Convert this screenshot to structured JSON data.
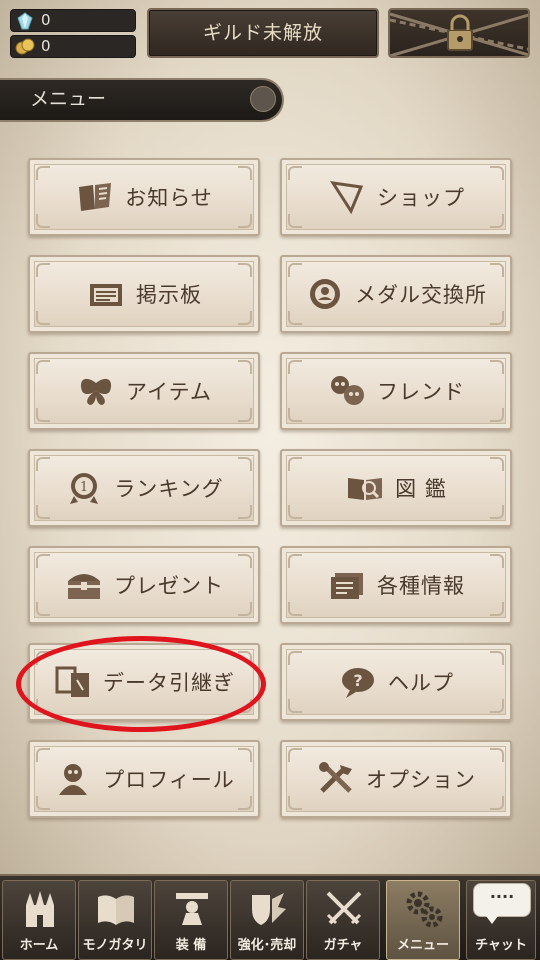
{
  "resources": {
    "gems": "0",
    "coins": "0",
    "gem_icon": "crystal-icon",
    "coin_icon": "coins-icon"
  },
  "guild_button_label": "ギルド未解放",
  "locked_icon": "padlock-chains-icon",
  "menu_header_label": "メニュー",
  "menu_buttons": [
    {
      "label": "お知らせ",
      "icon": "news-icon"
    },
    {
      "label": "ショップ",
      "icon": "shop-icon"
    },
    {
      "label": "掲示板",
      "icon": "board-icon"
    },
    {
      "label": "メダル交換所",
      "icon": "medal-exchange-icon"
    },
    {
      "label": "アイテム",
      "icon": "butterfly-icon"
    },
    {
      "label": "フレンド",
      "icon": "friends-icon"
    },
    {
      "label": "ランキング",
      "icon": "ranking-icon"
    },
    {
      "label": "図 鑑",
      "icon": "encyclopedia-icon"
    },
    {
      "label": "プレゼント",
      "icon": "present-chest-icon"
    },
    {
      "label": "各種情報",
      "icon": "info-icon"
    },
    {
      "label": "データ引継ぎ",
      "icon": "data-transfer-icon"
    },
    {
      "label": "ヘルプ",
      "icon": "help-icon"
    },
    {
      "label": "プロフィール",
      "icon": "profile-icon"
    },
    {
      "label": "オプション",
      "icon": "options-tools-icon"
    }
  ],
  "highlighted_button": "データ引継ぎ",
  "highlight_color": "#e0141c",
  "bottom_nav": [
    {
      "label": "ホーム",
      "icon": "castle-icon",
      "active": false
    },
    {
      "label": "モノガタリ",
      "icon": "book-icon",
      "active": false
    },
    {
      "label": "装 備",
      "icon": "equipment-icon",
      "active": false
    },
    {
      "label": "強化･売却",
      "icon": "enhance-sell-icon",
      "active": false
    },
    {
      "label": "ガチャ",
      "icon": "crossed-swords-icon",
      "active": false
    },
    {
      "label": "メニュー",
      "icon": "gears-icon",
      "active": true
    }
  ],
  "chat": {
    "label": "チャット",
    "bubble": "····"
  }
}
